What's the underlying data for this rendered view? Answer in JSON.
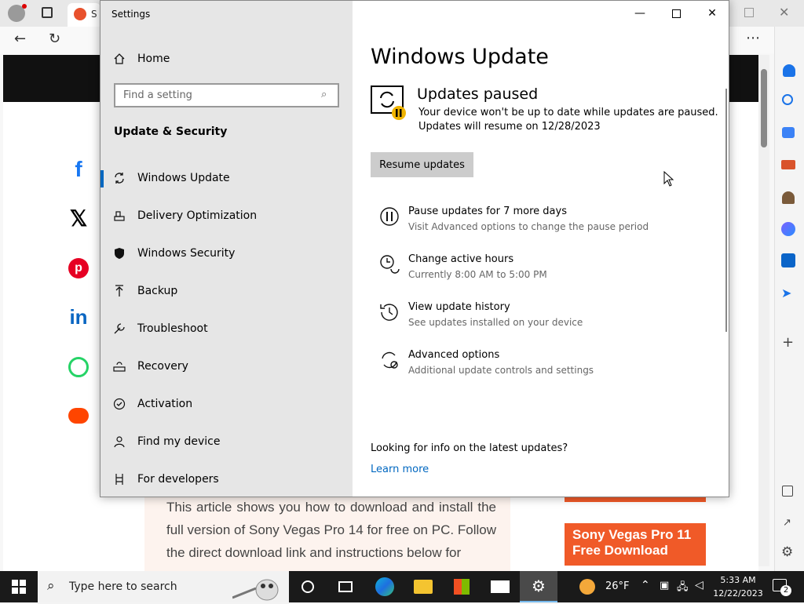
{
  "browser": {
    "tab_label": "S"
  },
  "article": {
    "text": "This article shows you how to download and install the full version of Sony Vegas Pro 14 for free on PC. Follow the direct download link and instructions below for"
  },
  "ad": {
    "line1": "Sony Vegas Pro 11",
    "line2": "Free Download"
  },
  "settings": {
    "window_title": "Settings",
    "home_label": "Home",
    "search_placeholder": "Find a setting",
    "section_title": "Update & Security",
    "nav": [
      {
        "label": "Windows Update",
        "icon": "sync-icon"
      },
      {
        "label": "Delivery Optimization",
        "icon": "delivery-icon"
      },
      {
        "label": "Windows Security",
        "icon": "shield-icon"
      },
      {
        "label": "Backup",
        "icon": "backup-icon"
      },
      {
        "label": "Troubleshoot",
        "icon": "wrench-icon"
      },
      {
        "label": "Recovery",
        "icon": "recovery-icon"
      },
      {
        "label": "Activation",
        "icon": "activation-icon"
      },
      {
        "label": "Find my device",
        "icon": "person-pin-icon"
      },
      {
        "label": "For developers",
        "icon": "developer-icon"
      }
    ],
    "main": {
      "title": "Windows Update",
      "status_title": "Updates paused",
      "status_line1": "Your device won't be up to date while updates are paused.",
      "status_line2": "Updates will resume on 12/28/2023",
      "resume_button": "Resume updates",
      "options": [
        {
          "title": "Pause updates for 7 more days",
          "subtitle": "Visit Advanced options to change the pause period",
          "icon": "pause-icon"
        },
        {
          "title": "Change active hours",
          "subtitle": "Currently 8:00 AM to 5:00 PM",
          "icon": "active-hours-icon"
        },
        {
          "title": "View update history",
          "subtitle": "See updates installed on your device",
          "icon": "history-icon"
        },
        {
          "title": "Advanced options",
          "subtitle": "Additional update controls and settings",
          "icon": "advanced-icon"
        }
      ],
      "info_question": "Looking for info on the latest updates?",
      "learn_more": "Learn more"
    }
  },
  "taskbar": {
    "search_placeholder": "Type here to search",
    "weather_temp": "26°F",
    "time": "5:33 AM",
    "date": "12/22/2023",
    "notification_count": "2"
  },
  "colors": {
    "accent": "#0067c0",
    "link": "#0067c0",
    "ad_orange": "#f05a28",
    "taskbar": "#1a1a1a"
  }
}
